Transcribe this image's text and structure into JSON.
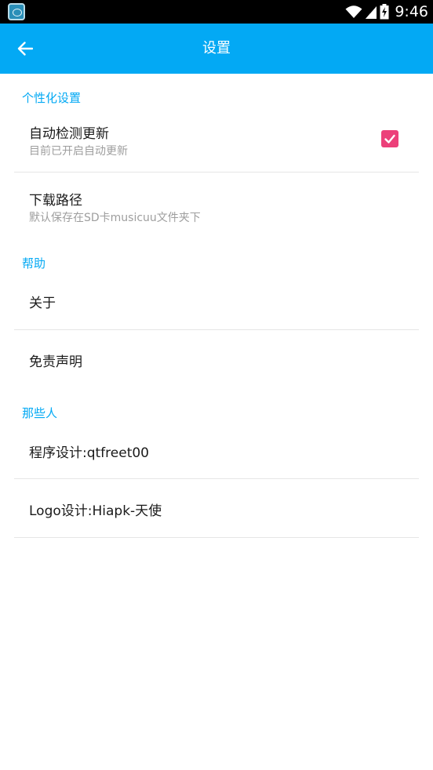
{
  "status_bar": {
    "time": "9:46",
    "icons": [
      "app-notification-icon",
      "wifi-icon",
      "signal-icon",
      "battery-icon"
    ]
  },
  "app_bar": {
    "title": "设置",
    "back_icon": "arrow-back-icon",
    "color": "#03a9f4"
  },
  "sections": {
    "personalization": {
      "header": "个性化设置",
      "auto_update": {
        "title": "自动检测更新",
        "subtitle": "目前已开启自动更新",
        "checked": true
      },
      "download_path": {
        "title": "下载路径",
        "subtitle": "默认保存在SD卡musicuu文件夹下"
      }
    },
    "help": {
      "header": "帮助",
      "about": {
        "title": "关于"
      },
      "disclaimer": {
        "title": "免责声明"
      }
    },
    "people": {
      "header": "那些人",
      "program_design": {
        "title": "程序设计:qtfreet00"
      },
      "logo_design": {
        "title": "Logo设计:Hiapk-天使"
      }
    }
  },
  "colors": {
    "accent": "#03a9f4",
    "checkbox": "#ec407a",
    "subtitle_text": "#9e9e9e"
  }
}
